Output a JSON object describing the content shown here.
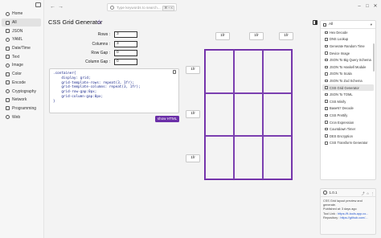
{
  "sidebar": {
    "items": [
      {
        "label": "Home",
        "icon": "home-icon"
      },
      {
        "label": "All",
        "icon": "grid-icon",
        "active": true
      },
      {
        "label": "JSON",
        "icon": "braces-icon"
      },
      {
        "label": "YAML",
        "icon": "file-icon"
      },
      {
        "label": "Date/Time",
        "icon": "clock-icon"
      },
      {
        "label": "Text",
        "icon": "text-icon"
      },
      {
        "label": "Image",
        "icon": "image-icon"
      },
      {
        "label": "Color",
        "icon": "palette-icon"
      },
      {
        "label": "Encode",
        "icon": "encode-icon"
      },
      {
        "label": "Cryptography",
        "icon": "lock-icon"
      },
      {
        "label": "Network",
        "icon": "network-icon"
      },
      {
        "label": "Programming",
        "icon": "code-icon"
      },
      {
        "label": "Web",
        "icon": "globe-icon"
      }
    ]
  },
  "topbar": {
    "search_placeholder": "Type keywords to search...",
    "shortcut": "⌘ + K",
    "back_glyph": "←",
    "forward_glyph": "→",
    "minimize_glyph": "–",
    "maximize_glyph": "□",
    "close_glyph": "✕"
  },
  "main": {
    "title": "CSS Grid Generator",
    "star_glyph": "☆",
    "form": {
      "rows_label": "Rows :",
      "rows_value": "3",
      "columns_label": "Columns :",
      "columns_value": "3",
      "row_gap_label": "Row Gap :",
      "row_gap_value": "0",
      "column_gap_label": "Column Gap :",
      "column_gap_value": "0"
    },
    "code": ".container{\n    display: grid;\n    grid-template-rows: repeat(3, 1fr);\n    grid-template-columns: repeat(3, 1fr);\n    grid-row-gap:0px;\n    grid-column-gap:0px;\n}",
    "show_html_label": "show HTML",
    "column_units": [
      "1fr",
      "1fr",
      "1fr"
    ],
    "row_units": [
      "1fr",
      "1fr",
      "1fr"
    ]
  },
  "tool_panel": {
    "header": "All",
    "items": [
      "Hex Decode",
      "DNS Lookup",
      "Generate Random Time",
      "Device Image",
      "JSON To Big Query Schema",
      "JSON To Haskell Module",
      "JSON To Scala",
      "JSON To Zod Schema",
      "CSS Grid Generator",
      "JSON To TOML",
      "CSS Minify",
      "BaseN? Decode",
      "CSS Prettify",
      "Cron Expression",
      "Countdown Timer",
      "DES Encryption",
      "CSS Transform Generator"
    ],
    "active_item": "CSS Grid Generator"
  },
  "info_card": {
    "version": "1.0.1",
    "description_line1": "CSS Grid layout preview and",
    "description_line2": "generate.",
    "published": "Published at: 3 days ago",
    "tool_link_label": "Tool Link : ",
    "tool_link_value": "https://it-tools.app.co...",
    "repo_label": "Repository : ",
    "repo_value": "https://github.com/..."
  }
}
